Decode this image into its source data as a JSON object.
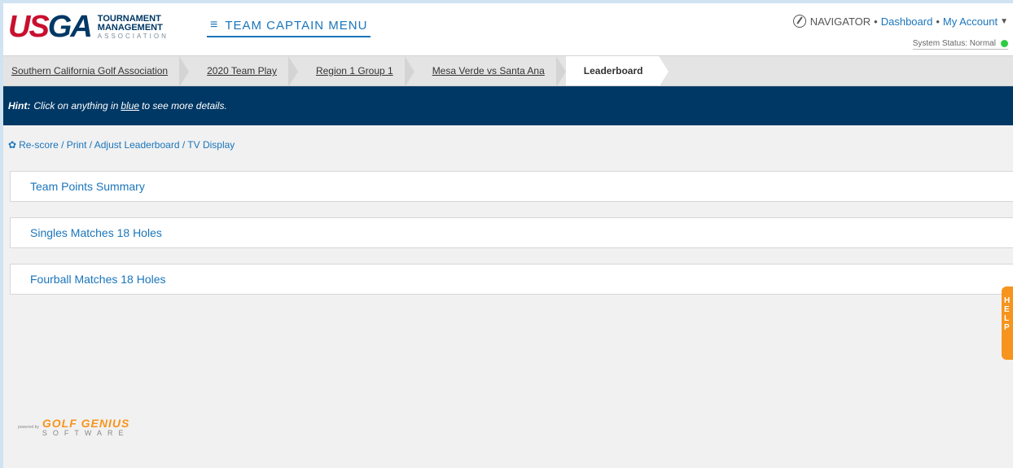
{
  "header": {
    "logo": {
      "mark_red": "US",
      "mark_blue": "GA",
      "line1": "TOURNAMENT",
      "line2": "MANAGEMENT",
      "line3": "ASSOCIATION"
    },
    "menu_label": "TEAM CAPTAIN MENU",
    "navigator_label": "NAVIGATOR",
    "dashboard_link": "Dashboard",
    "account_link": "My Account",
    "system_status": "System Status: Normal",
    "status_color": "#2ecc40"
  },
  "breadcrumb": [
    {
      "label": "Southern California Golf Association"
    },
    {
      "label": "2020 Team Play"
    },
    {
      "label": "Region 1 Group 1"
    },
    {
      "label": "Mesa Verde vs Santa Ana"
    },
    {
      "label": "Leaderboard"
    }
  ],
  "hint": {
    "prefix": "Hint:",
    "before": "Click on anything in",
    "keyword": "blue",
    "after": "to see more details."
  },
  "options_link": "Re-score / Print / Adjust Leaderboard / TV Display",
  "sections": [
    {
      "title": "Team Points Summary"
    },
    {
      "title": "Singles Matches 18 Holes"
    },
    {
      "title": "Fourball Matches 18 Holes"
    }
  ],
  "help_tab": {
    "letters": [
      "H",
      "E",
      "L",
      "P"
    ]
  },
  "footer": {
    "powered_by": "powered by",
    "brand": "GOLF GENIUS",
    "brand_sub": "SOFTWARE"
  },
  "colors": {
    "accent": "#1a75bb",
    "navy": "#003865",
    "brand_red": "#c8102e",
    "orange": "#f7941d"
  }
}
